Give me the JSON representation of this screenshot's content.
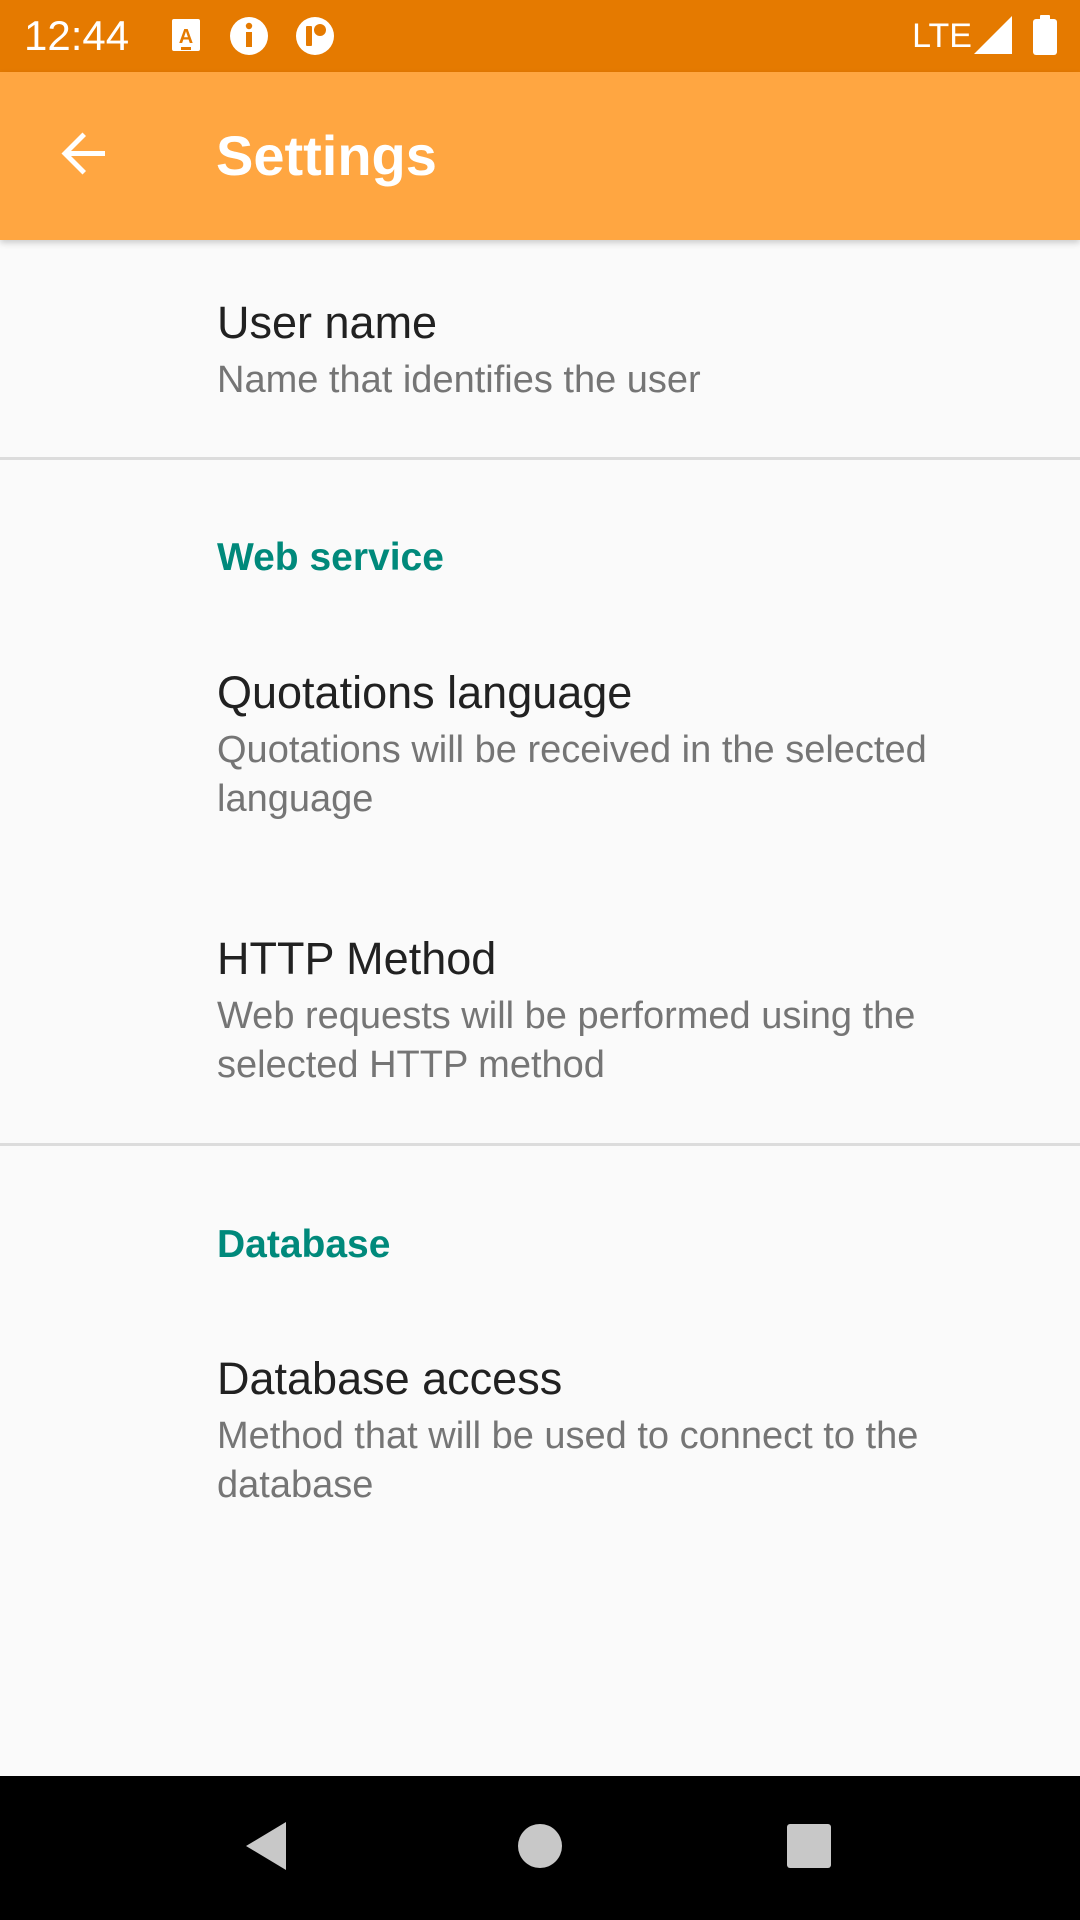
{
  "status_bar": {
    "time": "12:44",
    "network": "LTE",
    "icons": [
      "a-notification-icon",
      "info-icon",
      "app-notification-icon",
      "signal-icon",
      "battery-icon"
    ],
    "background_color": "#e57a00"
  },
  "app_bar": {
    "title": "Settings",
    "back_icon": "arrow-back-icon",
    "background_color": "#ffa641"
  },
  "preferences": {
    "user_name": {
      "title": "User name",
      "summary": "Name that identifies the user"
    },
    "web_service": {
      "category": "Web service",
      "quotations_language": {
        "title": "Quotations language",
        "summary": "Quotations will be received in the selected language"
      },
      "http_method": {
        "title": "HTTP Method",
        "summary": "Web requests will be performed using the selected HTTP method"
      }
    },
    "database": {
      "category": "Database",
      "database_access": {
        "title": "Database access",
        "summary": "Method that will be used to connect to the database"
      }
    },
    "category_color": "#00897b"
  },
  "nav_bar": {
    "buttons": [
      "back-triangle-icon",
      "home-circle-icon",
      "recents-square-icon"
    ]
  }
}
